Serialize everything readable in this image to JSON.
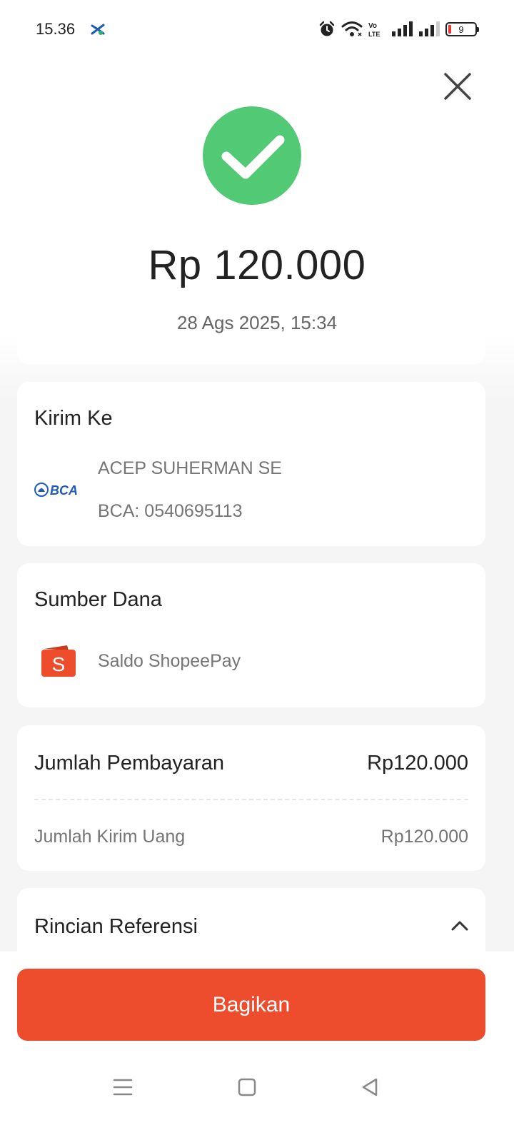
{
  "status_bar": {
    "time": "15.36",
    "battery_level": "9",
    "icons": [
      "xl-carrier-icon",
      "alarm-icon",
      "wifi-icon",
      "volte-icon",
      "signal-icon",
      "signal-icon",
      "battery-icon"
    ]
  },
  "transaction": {
    "amount": "Rp 120.000",
    "datetime": "28 Ags 2025, 15:34",
    "status_icon": "success-check-icon"
  },
  "recipient": {
    "title": "Kirim Ke",
    "bank_logo_text": "BCA",
    "name": "ACEP SUHERMAN SE",
    "account": "BCA: 0540695113"
  },
  "funding_source": {
    "title": "Sumber Dana",
    "name": "Saldo ShopeePay"
  },
  "payment": {
    "title": "Jumlah Pembayaran",
    "total": "Rp120.000",
    "row_label": "Jumlah Kirim Uang",
    "row_value": "Rp120.000"
  },
  "reference": {
    "title": "Rincian Referensi"
  },
  "share_button": {
    "label": "Bagikan"
  },
  "colors": {
    "accent": "#ee4d2d",
    "success": "#52c975",
    "bca_blue": "#1e5bb8"
  }
}
